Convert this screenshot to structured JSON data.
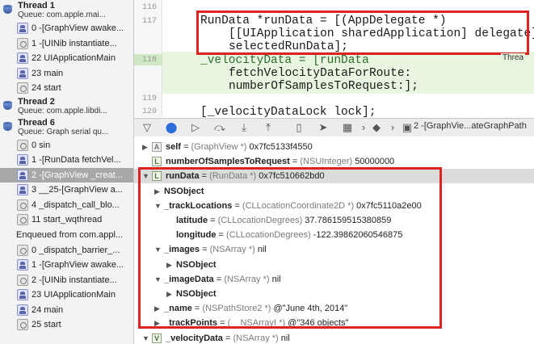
{
  "navigator": {
    "rows": [
      {
        "kind": "thread",
        "title": "Thread 1",
        "subtitle": "Queue: com.apple.mai..."
      },
      {
        "kind": "frame",
        "label": "0 -[GraphView awake..."
      },
      {
        "kind": "system",
        "label": "1 -[UINib instantiate..."
      },
      {
        "kind": "frame",
        "label": "22 UIApplicationMain"
      },
      {
        "kind": "frame",
        "label": "23 main"
      },
      {
        "kind": "system",
        "label": "24 start"
      },
      {
        "kind": "thread",
        "title": "Thread 2",
        "subtitle": "Queue: com.apple.libdi..."
      },
      {
        "kind": "thread",
        "title": "Thread 6",
        "subtitle": "Queue: Graph serial qu..."
      },
      {
        "kind": "system",
        "label": "0 sin"
      },
      {
        "kind": "frame",
        "label": "1 -[RunData fetchVel..."
      },
      {
        "kind": "frame",
        "label": "2 -[GraphView _creat...",
        "selected": true
      },
      {
        "kind": "frame",
        "label": "3 __25-[GraphView a..."
      },
      {
        "kind": "system",
        "label": "4 _dispatch_call_blo..."
      },
      {
        "kind": "system",
        "label": "11 start_wqthread"
      },
      {
        "kind": "enqueued",
        "label": "Enqueued from com.appl..."
      },
      {
        "kind": "system",
        "label": "0 _dispatch_barrier_..."
      },
      {
        "kind": "frame",
        "label": "1 -[GraphView awake..."
      },
      {
        "kind": "system",
        "label": "2 -[UINib instantiate..."
      },
      {
        "kind": "frame",
        "label": "23 UIApplicationMain"
      },
      {
        "kind": "frame",
        "label": "24 main"
      },
      {
        "kind": "system",
        "label": "25 start"
      }
    ]
  },
  "editor": {
    "line_numbers": [
      "116",
      "117",
      "118",
      "119",
      "120"
    ],
    "code": {
      "l117a": "RunData *runData = [(AppDelegate *)",
      "l117b": "[[UIApplication sharedApplication] delegate]",
      "l117c": "selectedRunData];",
      "l118a": "_velocityData = [runData",
      "l118b": "fetchVelocityDataForRoute:",
      "l118c": "numberOfSamplesToRequest:];",
      "l120": "[_velocityDataLock lock];"
    },
    "thread_tag": "Threa"
  },
  "debug_bar": {
    "breadcrumb": "2 -[GraphVie...ateGraphPath"
  },
  "variables": [
    {
      "indent": 0,
      "tri": "right",
      "icon": "A",
      "name": "self",
      "type": "(GraphView *)",
      "value": "0x7fc5133f4550"
    },
    {
      "indent": 0,
      "tri": "",
      "icon": "L",
      "name": "numberOfSamplesToRequest",
      "type": "(NSUInteger)",
      "value": "50000000"
    },
    {
      "indent": 0,
      "tri": "down",
      "icon": "L",
      "name": "runData",
      "type": "(RunData *)",
      "value": "0x7fc510662bd0",
      "selected": true
    },
    {
      "indent": 1,
      "tri": "right",
      "icon": "",
      "name": "NSObject",
      "type": "",
      "value": ""
    },
    {
      "indent": 1,
      "tri": "down",
      "icon": "",
      "name": "_trackLocations",
      "type": "(CLLocationCoordinate2D *)",
      "value": "0x7fc5110a2e00"
    },
    {
      "indent": 2,
      "tri": "",
      "icon": "",
      "name": "latitude",
      "type": "(CLLocationDegrees)",
      "value": "37.786159515380859"
    },
    {
      "indent": 2,
      "tri": "",
      "icon": "",
      "name": "longitude",
      "type": "(CLLocationDegrees)",
      "value": "-122.39862060546875"
    },
    {
      "indent": 1,
      "tri": "down",
      "icon": "",
      "name": "_images",
      "type": "(NSArray *)",
      "value": "nil"
    },
    {
      "indent": 2,
      "tri": "right",
      "icon": "",
      "name": "NSObject",
      "type": "",
      "value": ""
    },
    {
      "indent": 1,
      "tri": "down",
      "icon": "",
      "name": "_imageData",
      "type": "(NSArray *)",
      "value": "nil"
    },
    {
      "indent": 2,
      "tri": "right",
      "icon": "",
      "name": "NSObject",
      "type": "",
      "value": ""
    },
    {
      "indent": 1,
      "tri": "right",
      "icon": "",
      "name": "_name",
      "type": "(NSPathStore2 *)",
      "value": "@\"June 4th, 2014\""
    },
    {
      "indent": 1,
      "tri": "right",
      "icon": "",
      "name": "_trackPoints",
      "type": "(__NSArrayI *)",
      "value": "@\"346 objects\""
    },
    {
      "indent": 0,
      "tri": "down",
      "icon": "V",
      "name": "_velocityData",
      "type": "(NSArray *)",
      "value": "nil"
    }
  ],
  "colors": {
    "highlight_box": "#dd2222",
    "pc_line": "#cfe8c3",
    "selection": "#a8a8a8"
  }
}
